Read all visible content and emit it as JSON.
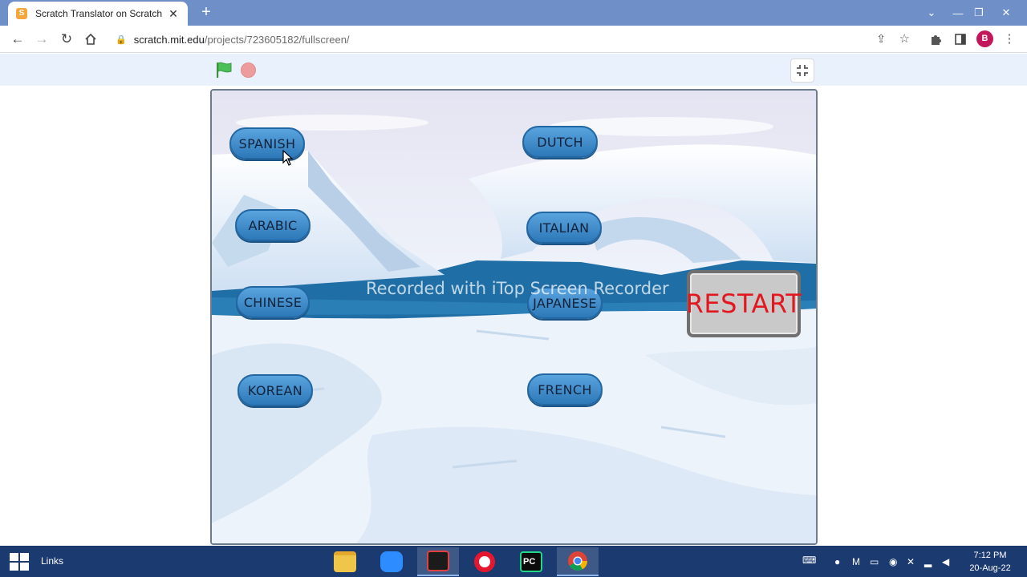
{
  "browser": {
    "tab_title": "Scratch Translator on Scratch",
    "tab_favicon_glyph": "S",
    "url_host": "scratch.mit.edu",
    "url_path": "/projects/723605182/fullscreen/",
    "avatar_initial": "B"
  },
  "scratch": {
    "buttons": {
      "spanish": "SPANISH",
      "dutch": "DUTCH",
      "arabic": "ARABIC",
      "italian": "ITALIAN",
      "chinese": "CHINESE",
      "japanese": "JAPANESE",
      "korean": "KOREAN",
      "french": "FRENCH"
    },
    "restart_label": "RESTART",
    "watermark": "Recorded with iTop Screen Recorder"
  },
  "taskbar": {
    "links_label": "Links",
    "time": "7:12 PM",
    "date": "20-Aug-22"
  },
  "colors": {
    "tabstrip": "#6f8fc9",
    "button_blue": "#2d78b8",
    "restart_text": "#e3171e",
    "taskbar": "#1b3a70"
  }
}
